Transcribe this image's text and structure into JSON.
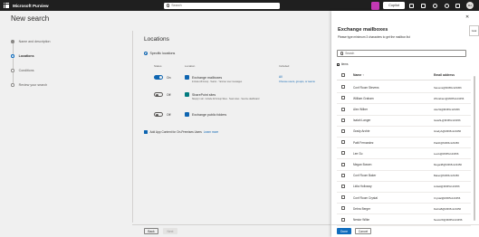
{
  "topbar": {
    "app_title": "Microsoft Purview",
    "search_placeholder": "Search",
    "copilot_label": "Copilot",
    "avatar_initials": "MA"
  },
  "page": {
    "title": "New search",
    "steps": [
      {
        "label": "Name and description",
        "state": "done"
      },
      {
        "label": "Locations",
        "state": "active"
      },
      {
        "label": "Conditions",
        "state": "pending"
      },
      {
        "label": "Review your search",
        "state": "pending"
      }
    ],
    "section_title": "Locations",
    "specific_locations": "Specific locations",
    "table_headers": {
      "status": "Status",
      "location": "Location",
      "included": "Included"
    },
    "locations": [
      {
        "status": "On",
        "name": "Exchange mailboxes",
        "sub": "Include All Group  ·  Teams  ·  Yammer user messages",
        "included": "All",
        "included2": "Choose users, groups, or teams",
        "on": true,
        "icon_color": "#0f6cbd"
      },
      {
        "status": "Off",
        "name": "SharePoint sites",
        "sub": "Site(s) in all  ·  Include All Group Sites  ·  Team sites  ·  Service dashboard",
        "included": "",
        "included2": "",
        "on": false,
        "icon_color": "#038387"
      },
      {
        "status": "Off",
        "name": "Exchange public folders",
        "sub": "",
        "included": "",
        "included2": "",
        "on": false,
        "icon_color": "#0f6cbd"
      }
    ],
    "add_app_text": "Add App Content for On-Premises Users",
    "learn_more": "Learn more",
    "back_label": "Back",
    "next_label": "Next"
  },
  "panel": {
    "title": "Exchange mailboxes",
    "subtitle": "Please type minimum 3 characters to get the mailbox list",
    "search_placeholder": "Search",
    "items_label": "items",
    "col_name": "Name",
    "col_email": "Email address",
    "side_tab": "Goal",
    "rows": [
      {
        "name": "Conf Room Stevens",
        "email": "Stevens@M365x123456"
      },
      {
        "name": "William Graham",
        "email": "WGraham@M365x123456"
      },
      {
        "name": "Alex Wilber",
        "email": "AlexW@M365x123456"
      },
      {
        "name": "Isaiah Langer",
        "email": "IsaiahL@M365x123456"
      },
      {
        "name": "Grady Archie",
        "email": "GradyA@M365x123456"
      },
      {
        "name": "Patti Fernandez",
        "email": "PattiF@M365x123456"
      },
      {
        "name": "Lee Gu",
        "email": "LeeG@M365x123456"
      },
      {
        "name": "Megan Bowen",
        "email": "MeganB@M365x123456"
      },
      {
        "name": "Conf Room Baker",
        "email": "Baker@M365x123456"
      },
      {
        "name": "Lidia Holloway",
        "email": "LidiaH@M365x123456"
      },
      {
        "name": "Conf Room Crystal",
        "email": "Crystal@M365x123456"
      },
      {
        "name": "Debra Berger",
        "email": "DebraB@M365x123456"
      },
      {
        "name": "Nestor Wilke",
        "email": "NestorW@M365x123456"
      }
    ],
    "done_label": "Done",
    "cancel_label": "Cancel"
  }
}
